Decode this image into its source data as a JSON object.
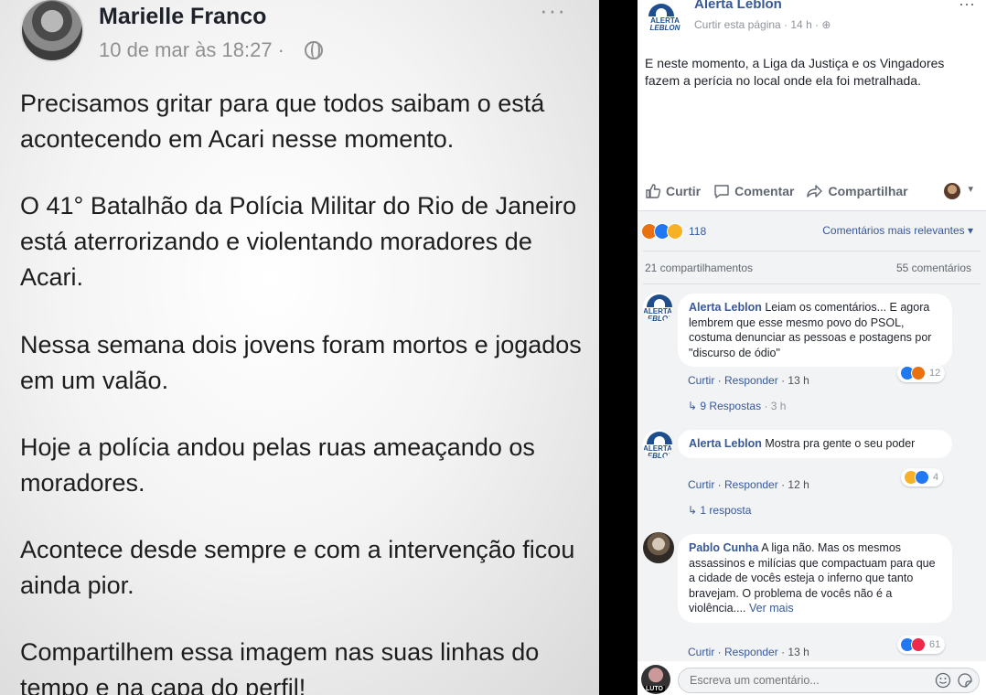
{
  "screenshot_post": {
    "author": "Marielle Franco",
    "date": "10 de mar às 18:27 ·",
    "more": "···",
    "paragraphs": [
      "Precisamos gritar para que todos saibam o está acontecendo em Acari nesse momento.",
      "O 41° Batalhão da Polícia Militar do Rio de Janeiro está aterrorizando e violentando moradores de Acari.",
      "Nessa semana dois jovens foram mortos e jogados em um valão.",
      "Hoje a polícia andou pelas ruas ameaçando os moradores.",
      "Acontece desde sempre e com a intervenção ficou ainda pior.",
      "Compartilhem essa imagem nas suas linhas do tempo e na capa do perfil!"
    ]
  },
  "page_post": {
    "logo_text_1": "ALERTA",
    "logo_text_2": "LEBLON",
    "author": "Alerta Leblon",
    "subline": "Curtir esta página · 14 h · ",
    "more": "···",
    "text": "E neste momento, a Liga da Justiça e os Vingadores fazem a perícia no local onde ela foi metralhada.",
    "actions": {
      "like": "Curtir",
      "comment": "Comentar",
      "share": "Compartilhar",
      "caret": "▾"
    },
    "reactions_count": "118",
    "sort_label": "Comentários mais relevantes ▾",
    "shares": "21 compartilhamentos",
    "comments_count": "55 comentários"
  },
  "comments": [
    {
      "name": "Alerta Leblon",
      "text": "Leiam os comentários... E agora lembrem que esse mesmo povo do PSOL, costuma denunciar as pessoas e postagens por \"discurso de ódio\"",
      "like": "Curtir",
      "reply": "Responder",
      "time": "13 h",
      "reactions": "12",
      "replies": "9 Respostas",
      "replies_time": "· 3 h"
    },
    {
      "name": "Alerta Leblon",
      "text": "Mostra pra gente o seu poder",
      "like": "Curtir",
      "reply": "Responder",
      "time": "12 h",
      "reactions": "4",
      "replies": "1 resposta"
    },
    {
      "name": "Pablo Cunha",
      "text": "A liga não. Mas os mesmos assassinos e milícias que compactuam para que a cidade de vocês esteja o inferno que tanto bravejam. O problema de vocês não é a violência....",
      "see_more": "Ver mais",
      "like": "Curtir",
      "reply": "Responder",
      "time": "13 h",
      "reactions": "61"
    }
  ],
  "composer": {
    "placeholder": "Escreva um comentário...",
    "avatar_tag": "LUTO"
  },
  "colors": {
    "link": "#385898",
    "like_blue": "#2078f4",
    "angry": "#e9710f",
    "haha": "#f7b125",
    "love": "#f0284a"
  }
}
